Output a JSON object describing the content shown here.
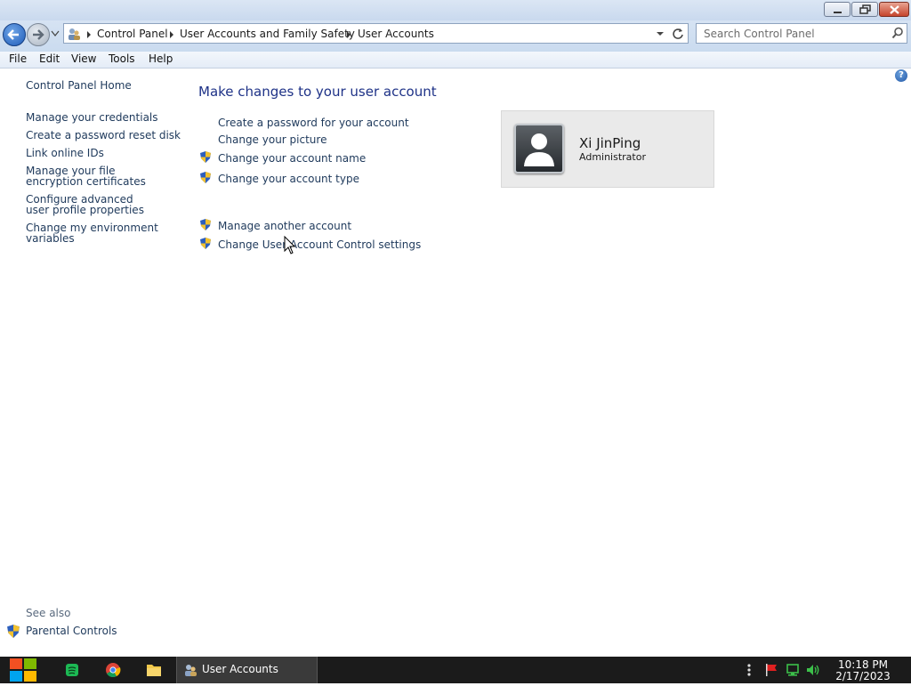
{
  "window": {
    "caption_buttons": [
      "minimize",
      "restore",
      "close"
    ]
  },
  "address_bar": {
    "breadcrumbs": [
      "Control Panel",
      "User Accounts and Family Safety",
      "User Accounts"
    ],
    "search_placeholder": "Search Control Panel"
  },
  "menu": {
    "items": [
      "File",
      "Edit",
      "View",
      "Tools",
      "Help"
    ]
  },
  "left_pane": {
    "home": "Control Panel Home",
    "links": [
      "Manage your credentials",
      "Create a password reset disk",
      "Link online IDs",
      "Manage your file encryption certificates",
      "Configure advanced user profile properties",
      "Change my environment variables"
    ],
    "see_also": {
      "heading": "See also",
      "items": [
        "Parental Controls"
      ]
    }
  },
  "main": {
    "title": "Make changes to your user account",
    "tasks": [
      {
        "label": "Create a password for your account",
        "shield": false
      },
      {
        "label": "Change your picture",
        "shield": false
      },
      {
        "label": "Change your account name",
        "shield": true
      },
      {
        "label": "Change your account type",
        "shield": true
      }
    ],
    "other_tasks": [
      {
        "label": "Manage another account",
        "shield": true
      },
      {
        "label": "Change User Account Control settings",
        "shield": true
      }
    ],
    "user": {
      "name": "Xi JinPing",
      "role": "Administrator"
    }
  },
  "help_icon": "help-icon",
  "taskbar": {
    "pinned": [
      "start-icon",
      "spotify-icon",
      "chrome-icon",
      "file-explorer-icon"
    ],
    "active_app": "User Accounts",
    "tray_icons": [
      "overflow-icon",
      "action-center-flag-icon",
      "network-icon",
      "volume-icon"
    ],
    "time": "10:18 PM",
    "date": "2/17/2023"
  },
  "colors": {
    "link": "#1e395b",
    "title": "#1e3287",
    "taskbar": "#1b1b1b"
  }
}
